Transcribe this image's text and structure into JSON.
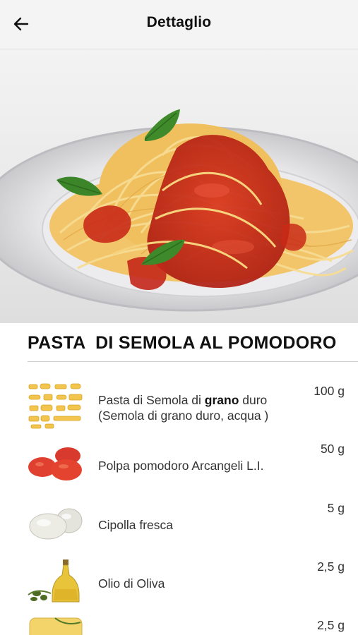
{
  "header": {
    "title": "Dettaglio",
    "back_icon": "arrow-left-icon"
  },
  "hero": {
    "image": "spaghetti-al-pomodoro-photo"
  },
  "dish_title": "PASTA  DI SEMOLA AL POMODORO",
  "ingredients": [
    {
      "name_pre": "Pasta di Semola di ",
      "name_bold": "grano",
      "name_post": " duro",
      "name_line2": "(Semola di grano duro, acqua )",
      "qty": "100 g",
      "icon": "pasta-shapes-icon"
    },
    {
      "name": "Polpa pomodoro Arcangeli L.I.",
      "qty": "50 g",
      "icon": "tomatoes-icon"
    },
    {
      "name": "Cipolla fresca",
      "qty": "5 g",
      "icon": "onions-icon"
    },
    {
      "name": "Olio di Oliva",
      "qty": "2,5 g",
      "icon": "olive-oil-bottle-icon"
    },
    {
      "name": "",
      "qty": "2,5 g",
      "icon": "oil-jar-icon"
    }
  ]
}
